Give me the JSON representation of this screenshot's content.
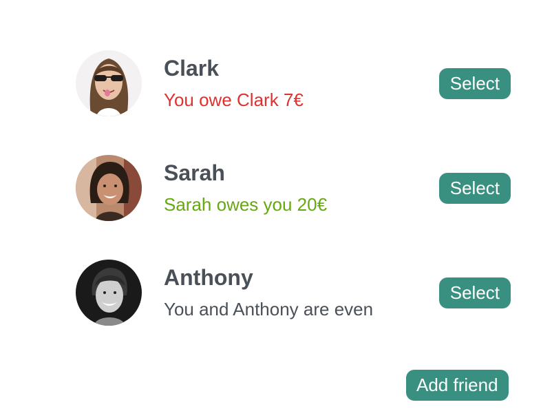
{
  "friends": [
    {
      "name": "Clark",
      "status": "You owe Clark 7€",
      "status_kind": "owe",
      "button": "Select",
      "avatar": "avatar-clark"
    },
    {
      "name": "Sarah",
      "status": "Sarah owes you 20€",
      "status_kind": "owed",
      "button": "Select",
      "avatar": "avatar-sarah"
    },
    {
      "name": "Anthony",
      "status": "You and Anthony are even",
      "status_kind": "even",
      "button": "Select",
      "avatar": "avatar-anthony"
    }
  ],
  "add_friend_label": "Add friend",
  "colors": {
    "accent": "#3a9080",
    "owe": "#e03131",
    "owed": "#66a80f",
    "text": "#495057"
  }
}
